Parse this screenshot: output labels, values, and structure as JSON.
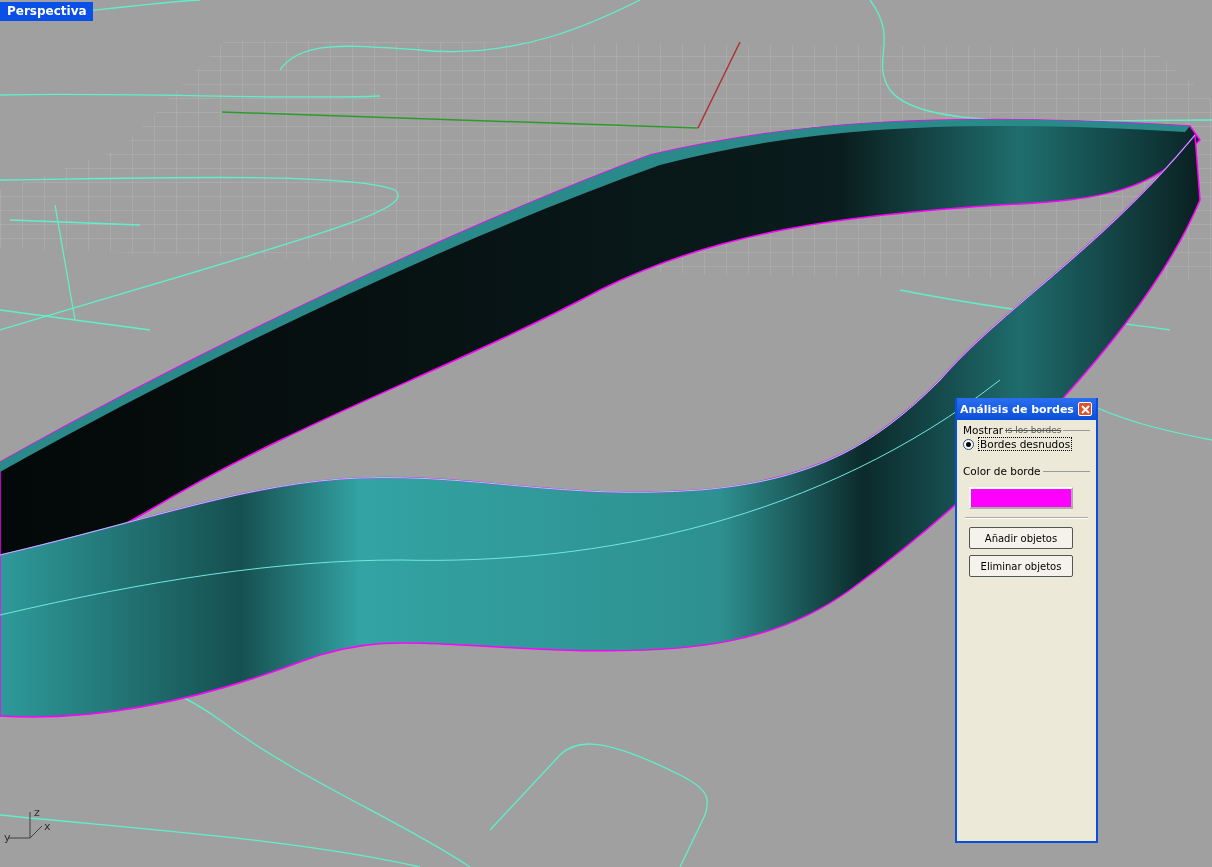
{
  "viewport": {
    "label": "Perspectiva",
    "axis_labels": [
      {
        "kind": "z",
        "text": "z"
      },
      {
        "kind": "y",
        "text": "y"
      },
      {
        "kind": "x",
        "text": "x"
      }
    ]
  },
  "dialog": {
    "title": "Análisis de bordes",
    "group_label": "Mostrar",
    "group_label_overlap": "ıs los bordes",
    "options": [
      {
        "label": "Bordes desnudos",
        "selected": true
      }
    ],
    "color_label": "Color de borde",
    "swatch": {
      "color": "#ff00ff"
    },
    "buttons": [
      "Añadir objetos",
      "Eliminar objetos"
    ]
  }
}
